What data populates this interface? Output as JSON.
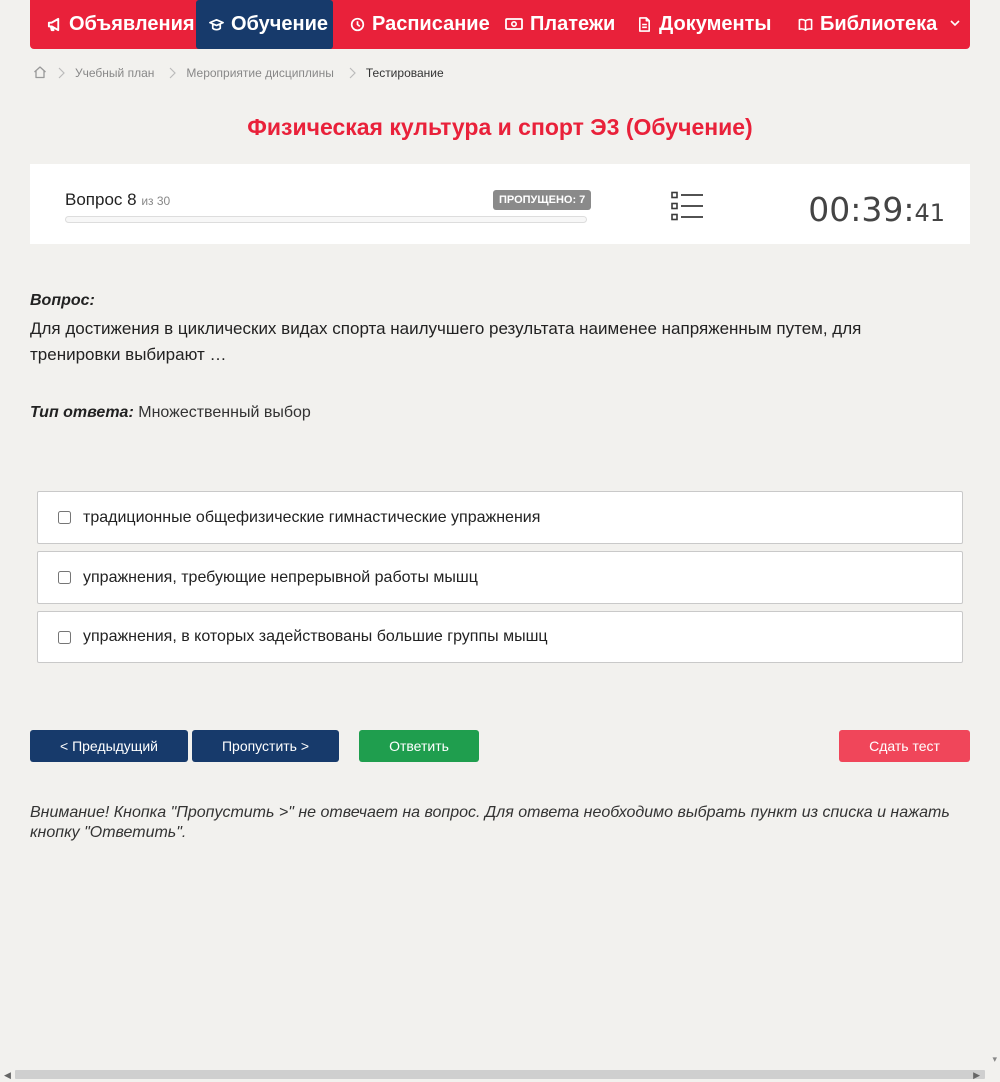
{
  "nav": {
    "items": [
      {
        "label": "Объявления",
        "icon": "megaphone-icon",
        "active": false
      },
      {
        "label": "Обучение",
        "icon": "graduation-cap-icon",
        "active": true
      },
      {
        "label": "Расписание",
        "icon": "clock-icon",
        "active": false
      },
      {
        "label": "Платежи",
        "icon": "money-icon",
        "active": false
      },
      {
        "label": "Документы",
        "icon": "document-icon",
        "active": false
      },
      {
        "label": "Библиотека",
        "icon": "book-icon",
        "active": false
      }
    ]
  },
  "breadcrumb": {
    "home_icon": "home-icon",
    "items": [
      "Учебный план",
      "Мероприятие дисциплины",
      "Тестирование"
    ]
  },
  "page_title": "Физическая культура и спорт Э3 (Обучение)",
  "progress": {
    "question_label": "Вопрос 8",
    "of_label": "из 30",
    "skipped_label": "ПРОПУЩЕНО: 7",
    "progress_fraction": 0.0,
    "list_icon": "list-icon",
    "timer_main": "00:39:",
    "timer_seconds": "41"
  },
  "question": {
    "label": "Вопрос:",
    "text": "Для достижения в циклических видах спорта наилучшего результата наименее напряженным путем, для тренировки выбирают …",
    "type_label": "Тип ответа:",
    "type_value": "Множественный выбор"
  },
  "options": [
    {
      "label": "традиционные общефизические гимнастические упражнения",
      "checked": false
    },
    {
      "label": "упражнения, требующие непрерывной работы мышц",
      "checked": false
    },
    {
      "label": "упражнения, в которых задействованы большие группы мышц",
      "checked": false
    }
  ],
  "buttons": {
    "prev": "< Предыдущий",
    "skip": "Пропустить >",
    "answer": "Ответить",
    "submit": "Сдать тест"
  },
  "notice": "Внимание! Кнопка \"Пропустить >\" не отвечает на вопрос. Для ответа необходимо выбрать пункт из списка и нажать кнопку \"Ответить\".",
  "colors": {
    "brand_red": "#e9213a",
    "nav_active": "#173a6b",
    "button_green": "#1f9e4e",
    "button_red": "#f0465a"
  }
}
